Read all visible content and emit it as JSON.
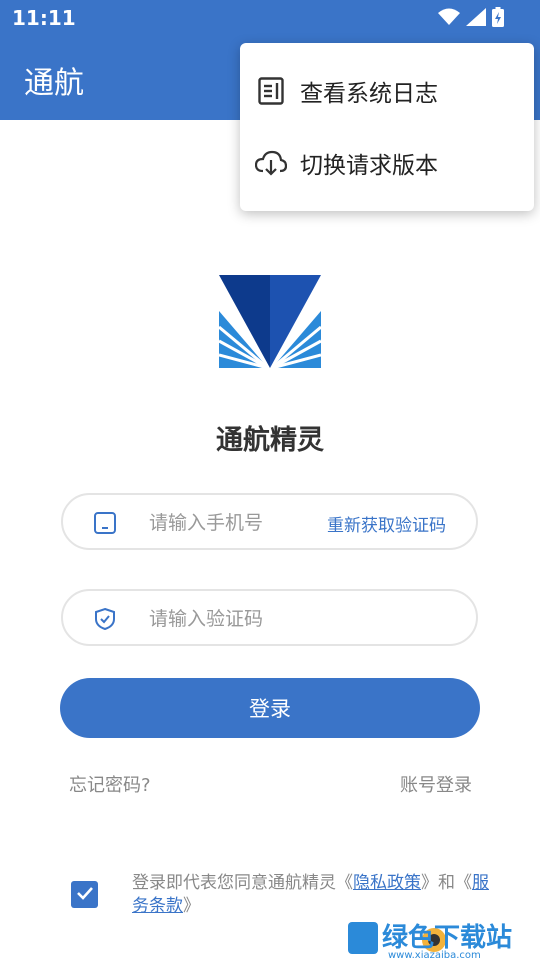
{
  "status": {
    "time": "11:11"
  },
  "app": {
    "title": "通航",
    "name": "通航精灵"
  },
  "menu": {
    "items": [
      {
        "label": "查看系统日志",
        "icon": "log-icon"
      },
      {
        "label": "切换请求版本",
        "icon": "cloud-download-icon"
      }
    ]
  },
  "form": {
    "phone_placeholder": "请输入手机号",
    "resend_label": "重新获取验证码",
    "code_placeholder": "请输入验证码",
    "login_label": "登录",
    "forgot_label": "忘记密码?",
    "account_login_label": "账号登录"
  },
  "agreement": {
    "checked": true,
    "prefix": "登录即代表您同意通航精灵",
    "lq1": "《",
    "privacy": "隐私政策",
    "rq1": "》",
    "and": "和",
    "lq2": "《",
    "terms": "服务条款",
    "rq2": "》"
  },
  "watermark": {
    "brand": "绿色下载站",
    "url": "www.xiazaiba.com"
  },
  "colors": {
    "primary": "#3a74c8",
    "logo_dark": "#0d3a8c",
    "logo_light": "#2b8ad9"
  }
}
